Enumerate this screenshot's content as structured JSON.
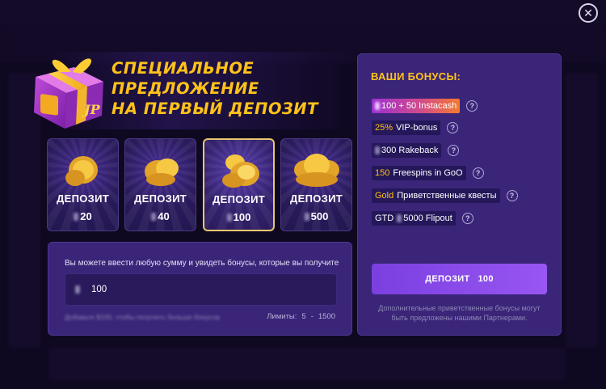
{
  "close": {
    "icon": "close-icon",
    "glyph": "✕"
  },
  "promo": {
    "title_line1": "СПЕЦИАЛЬНОЕ",
    "title_line2": "ПРЕДЛОЖЕНИЕ",
    "title_line3": "НА ПЕРВЫЙ ДЕПОЗИТ",
    "gift_badge": "JP"
  },
  "cards": [
    {
      "label": "ДЕПОЗИТ",
      "amount": "20",
      "selected": false
    },
    {
      "label": "ДЕПОЗИТ",
      "amount": "40",
      "selected": false
    },
    {
      "label": "ДЕПОЗИТ",
      "amount": "100",
      "selected": true
    },
    {
      "label": "ДЕПОЗИТ",
      "amount": "500",
      "selected": false
    }
  ],
  "input": {
    "hint": "Вы можете ввести любую сумму и увидеть бонусы, которые вы получите",
    "value": "100",
    "limits_label": "Лимиты:",
    "limit_min": "5",
    "limit_sep": "-",
    "limit_max": "1500"
  },
  "bonuses": {
    "title": "ВАШИ БОНУСЫ:",
    "items": [
      {
        "highlight": "",
        "text": "100 + 50 Instacash"
      },
      {
        "highlight": "25%",
        "text": "VIP-bonus"
      },
      {
        "highlight": "",
        "text": "300 Rakeback"
      },
      {
        "highlight": "150",
        "text": "Freespins in GoO"
      },
      {
        "highlight": "Gold",
        "text": "Приветственные квесты"
      },
      {
        "highlight": "GTD",
        "text": "5000 Flipout"
      }
    ],
    "help_glyph": "?",
    "deposit_label": "ДЕПОЗИТ",
    "deposit_amount": "100",
    "note": "Дополнительные приветственные бонусы могут быть предложены нашими Партнерами."
  },
  "colors": {
    "accent_gold": "#ffc21a",
    "panel": "#3a2578",
    "button": "#8a4cec"
  }
}
